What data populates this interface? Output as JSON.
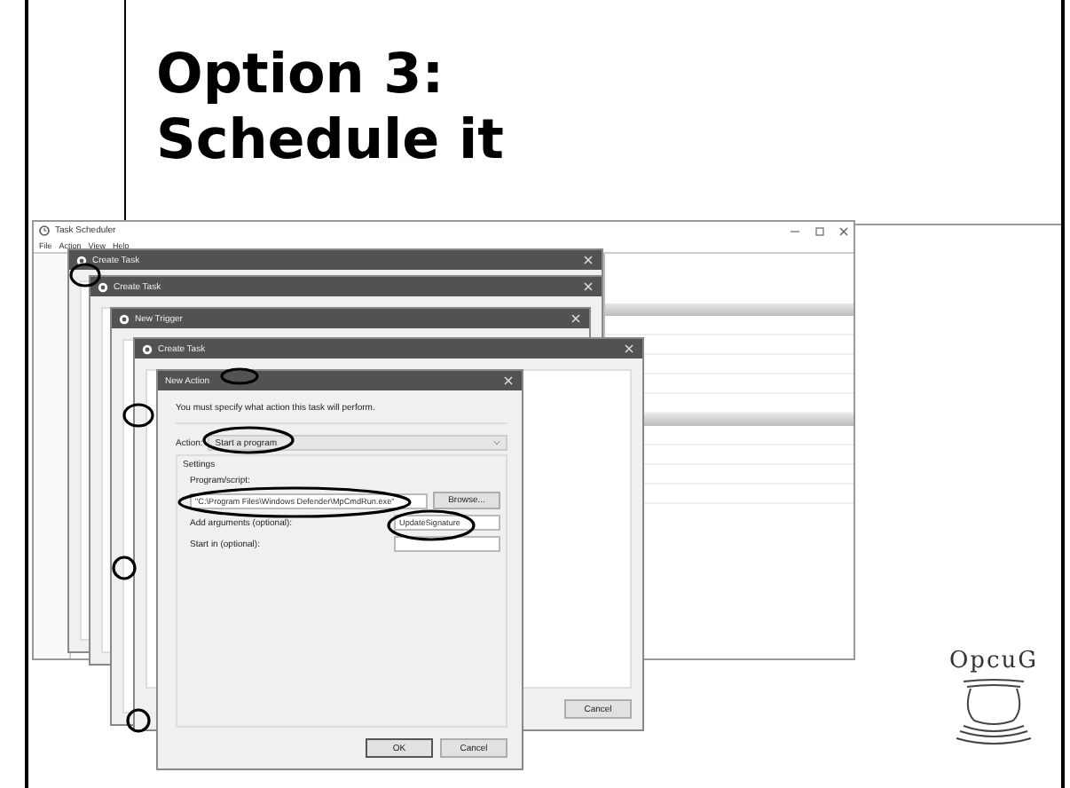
{
  "slide": {
    "title": "Option 3:\nSchedule it"
  },
  "main_window": {
    "title": "Task Scheduler",
    "menu": [
      "File",
      "Action",
      "View",
      "Help"
    ]
  },
  "dialogs": [
    {
      "kind": "back",
      "title": "Create Task"
    },
    {
      "kind": "back",
      "title": "Create Task"
    },
    {
      "kind": "back",
      "title": "New Trigger"
    },
    {
      "kind": "back",
      "title": "Create Task",
      "buttons": [
        "Cancel"
      ]
    },
    {
      "kind": "front",
      "title": "New Action"
    }
  ],
  "new_action": {
    "instruction": "You must specify what action this task will perform.",
    "action_label": "Action:",
    "action_value": "Start a program",
    "settings_label": "Settings",
    "program_label": "Program/script:",
    "program_value": "\"C:\\Program Files\\Windows Defender\\MpCmdRun.exe\"",
    "browse": "Browse...",
    "arguments_label": "Add arguments (optional):",
    "arguments_value": "UpdateSignature",
    "start_in_label": "Start in (optional):",
    "buttons": [
      "OK",
      "Cancel"
    ]
  },
  "logo": {
    "text": "OpcuG"
  }
}
